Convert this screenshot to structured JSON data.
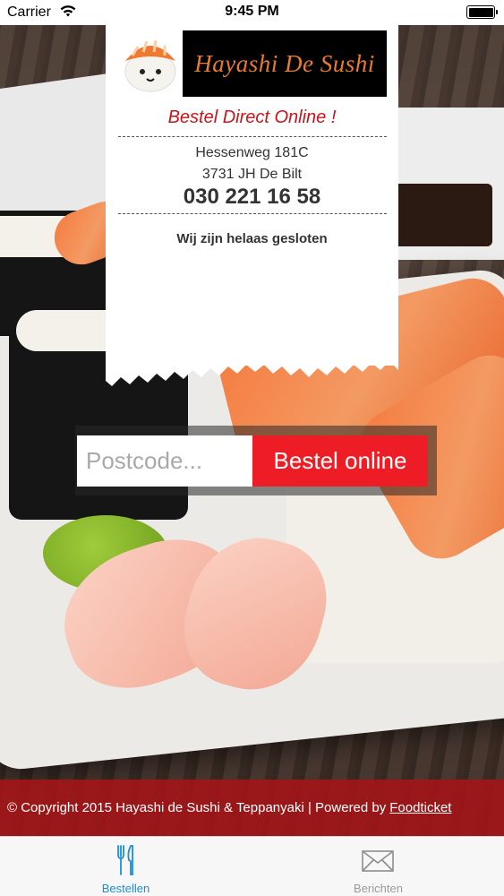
{
  "status_bar": {
    "carrier": "Carrier",
    "time": "9:45 PM",
    "wifi_icon": "wifi-icon",
    "battery_icon": "battery-icon"
  },
  "card": {
    "logo_text": "Hayashi De Sushi",
    "mascot_icon": "sushi-mascot-icon",
    "headline": "Bestel Direct Online !",
    "address_line1": "Hessenweg 181C",
    "address_line2": "3731 JH De Bilt",
    "phone": "030 221 16 58",
    "status": "Wij zijn helaas gesloten"
  },
  "order": {
    "postcode_placeholder": "Postcode...",
    "postcode_value": "",
    "button_label": "Bestel online"
  },
  "footer": {
    "copyright": "© Copyright 2015 Hayashi de Sushi & Teppanyaki | Powered by",
    "link": "Foodticket"
  },
  "tabs": [
    {
      "label": "Bestellen",
      "icon": "fork-knife-icon",
      "active": true
    },
    {
      "label": "Berichten",
      "icon": "envelope-icon",
      "active": false
    }
  ],
  "colors": {
    "brand_red": "#ee1c25",
    "headline_red": "#c8141a",
    "footer_red": "#a61418",
    "active_tab_blue": "#1a8fdb",
    "logo_orange": "#e87c2c"
  }
}
